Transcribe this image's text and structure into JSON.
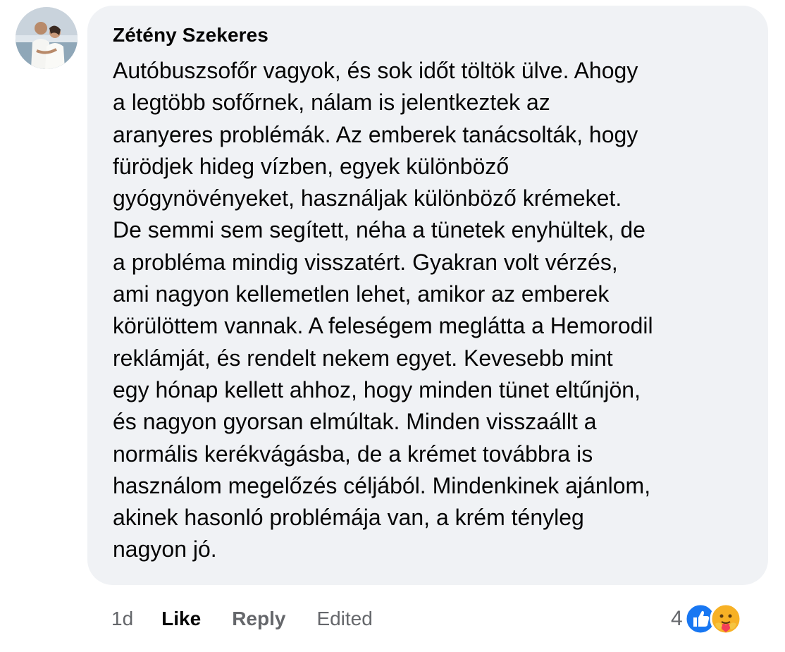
{
  "comment": {
    "author": "Zétény Szekeres",
    "text": "Autóbuszsofőr vagyok, és sok időt töltök ülve. Ahogy\na legtöbb sofőrnek, nálam is jelentkeztek az\naranyeres problémák. Az emberek tanácsolták, hogy\nfürödjek hideg vízben, egyek különböző\ngyógynövényeket, használjak különböző krémeket.\nDe semmi sem segített, néha a tünetek enyhültek, de\na probléma mindig visszatért. Gyakran volt vérzés,\nami nagyon kellemetlen lehet, amikor az emberek\nkörülöttem vannak. A feleségem meglátta a Hemorodil\nreklámját, és rendelt nekem egyet. Kevesebb mint\negy hónap kellett ahhoz, hogy minden tünet eltűnjön,\nés nagyon gyorsan elmúltak. Minden visszaállt a\nnormális kerékvágásba, de a krémet továbbra is\nhasználom megelőzés céljából. Mindenkinek ajánlom,\nakinek hasonló problémája van, a krém tényleg\nnagyon jó."
  },
  "actions": {
    "time": "1d",
    "like": "Like",
    "reply": "Reply",
    "edited": "Edited"
  },
  "reactions": {
    "count": "4",
    "types": [
      "like-reaction-icon",
      "care-reaction-icon"
    ],
    "like_color": "#1877f2",
    "care_color": "#f7b125"
  }
}
